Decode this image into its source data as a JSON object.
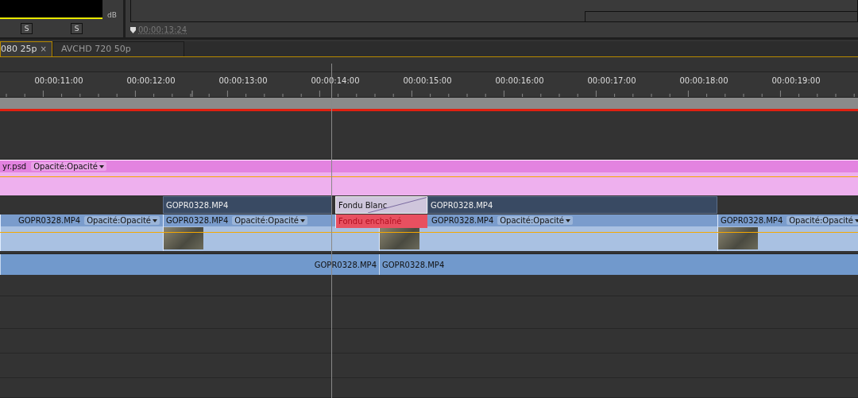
{
  "meter": {
    "unit": "dB",
    "solo_buttons": [
      "S",
      "S"
    ]
  },
  "monitor": {
    "timecode": "00:00:13:24"
  },
  "tabs": [
    {
      "label": "080 25p",
      "selected": true,
      "close": "×"
    },
    {
      "label": "AVCHD 720 50p",
      "selected": false
    }
  ],
  "ruler": {
    "timecodes": [
      "00:00:11:00",
      "00:00:12:00",
      "00:00:13:00",
      "00:00:14:00",
      "00:00:15:00",
      "00:00:16:00",
      "00:00:17:00",
      "00:00:18:00",
      "00:00:19:00"
    ]
  },
  "graphic_track": {
    "clip": "yr.psd",
    "effect": "Opacité:Opacité"
  },
  "video_track_upper": [
    {
      "kind": "clip",
      "name": "GOPR0328.MP4"
    },
    {
      "kind": "transition",
      "name": "Fondu Blanc"
    },
    {
      "kind": "clip",
      "name": "GOPR0328.MP4"
    }
  ],
  "video_track_lower": [
    {
      "kind": "clip",
      "name": "GOPR0328.MP4",
      "effect": "Opacité:Opacité",
      "thumbnail": false
    },
    {
      "kind": "clip",
      "name": "GOPR0328.MP4",
      "effect": "Opacité:Opacité",
      "thumbnail": true
    },
    {
      "kind": "transition",
      "name": "Fondu enchaîné"
    },
    {
      "kind": "clip",
      "name": "GOPR0328.MP4",
      "effect": "Opacité:Opacité",
      "thumbnail": true
    },
    {
      "kind": "clip",
      "name": "GOPR0328.MP4",
      "effect": "Opacité:Opacité",
      "thumbnail": true
    }
  ],
  "audio_track": [
    {
      "name": "GOPR0328.MP4"
    },
    {
      "name": "GOPR0328.MP4"
    }
  ]
}
